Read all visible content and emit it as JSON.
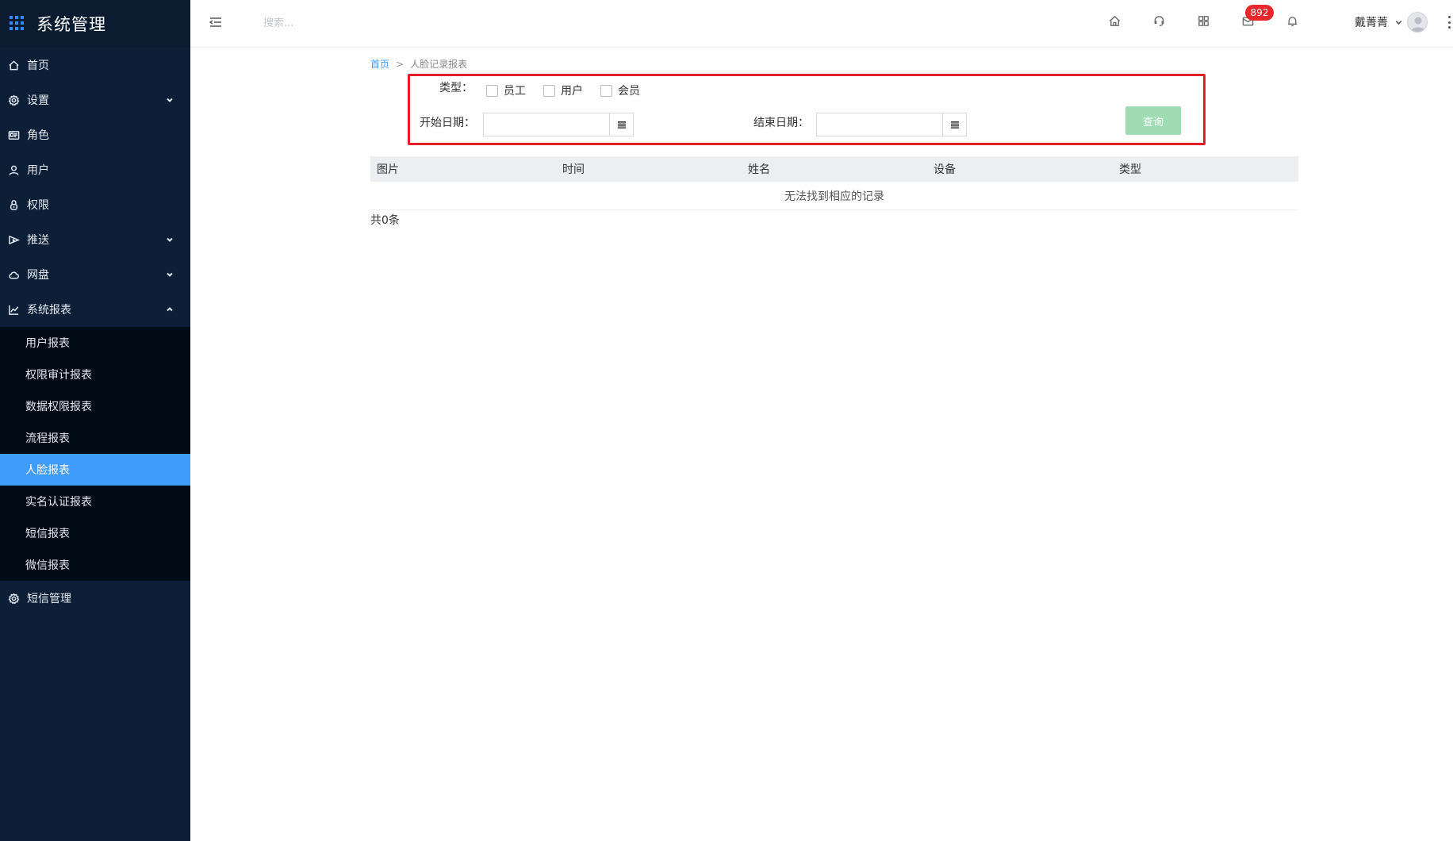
{
  "sidebar": {
    "brand_title": "系统管理",
    "brand_icon": "grid-icon",
    "items": [
      {
        "label": "首页",
        "icon": "home-icon"
      },
      {
        "label": "设置",
        "icon": "gear-icon"
      },
      {
        "label": "角色",
        "icon": "id-card-icon"
      },
      {
        "label": "用户",
        "icon": "user-icon"
      },
      {
        "label": "权限",
        "icon": "lock-icon"
      },
      {
        "label": "推送",
        "icon": "send-icon"
      },
      {
        "label": "网盘",
        "icon": "cloud-icon"
      },
      {
        "label": "系统报表",
        "icon": "chart-icon"
      },
      {
        "label": "短信管理",
        "icon": "gear-icon"
      }
    ],
    "report_sub": [
      "用户报表",
      "权限审计报表",
      "数据权限报表",
      "流程报表",
      "人脸报表",
      "实名认证报表",
      "短信报表",
      "微信报表"
    ],
    "active_sub": "人脸报表",
    "active_color": "#3f9cfb"
  },
  "header": {
    "search_placeholder": "搜索...",
    "icons": [
      "home-icon",
      "headset-icon",
      "apps-icon",
      "mail-icon",
      "bell-icon"
    ],
    "mail_badge": "892",
    "user_name": "戴菁菁"
  },
  "breadcrumb": {
    "home": "首页",
    "separator": ">",
    "current": "人脸记录报表"
  },
  "filter": {
    "type_label": "类型：",
    "types": [
      "员工",
      "用户",
      "会员"
    ],
    "start_label": "开始日期：",
    "end_label": "结束日期：",
    "start_value": "",
    "end_value": "",
    "query_label": "查询",
    "highlight_color": "#e21f26"
  },
  "table": {
    "columns": [
      "图片",
      "时间",
      "姓名",
      "设备",
      "类型"
    ],
    "empty_text": "无法找到相应的记录",
    "total": "共0条"
  }
}
